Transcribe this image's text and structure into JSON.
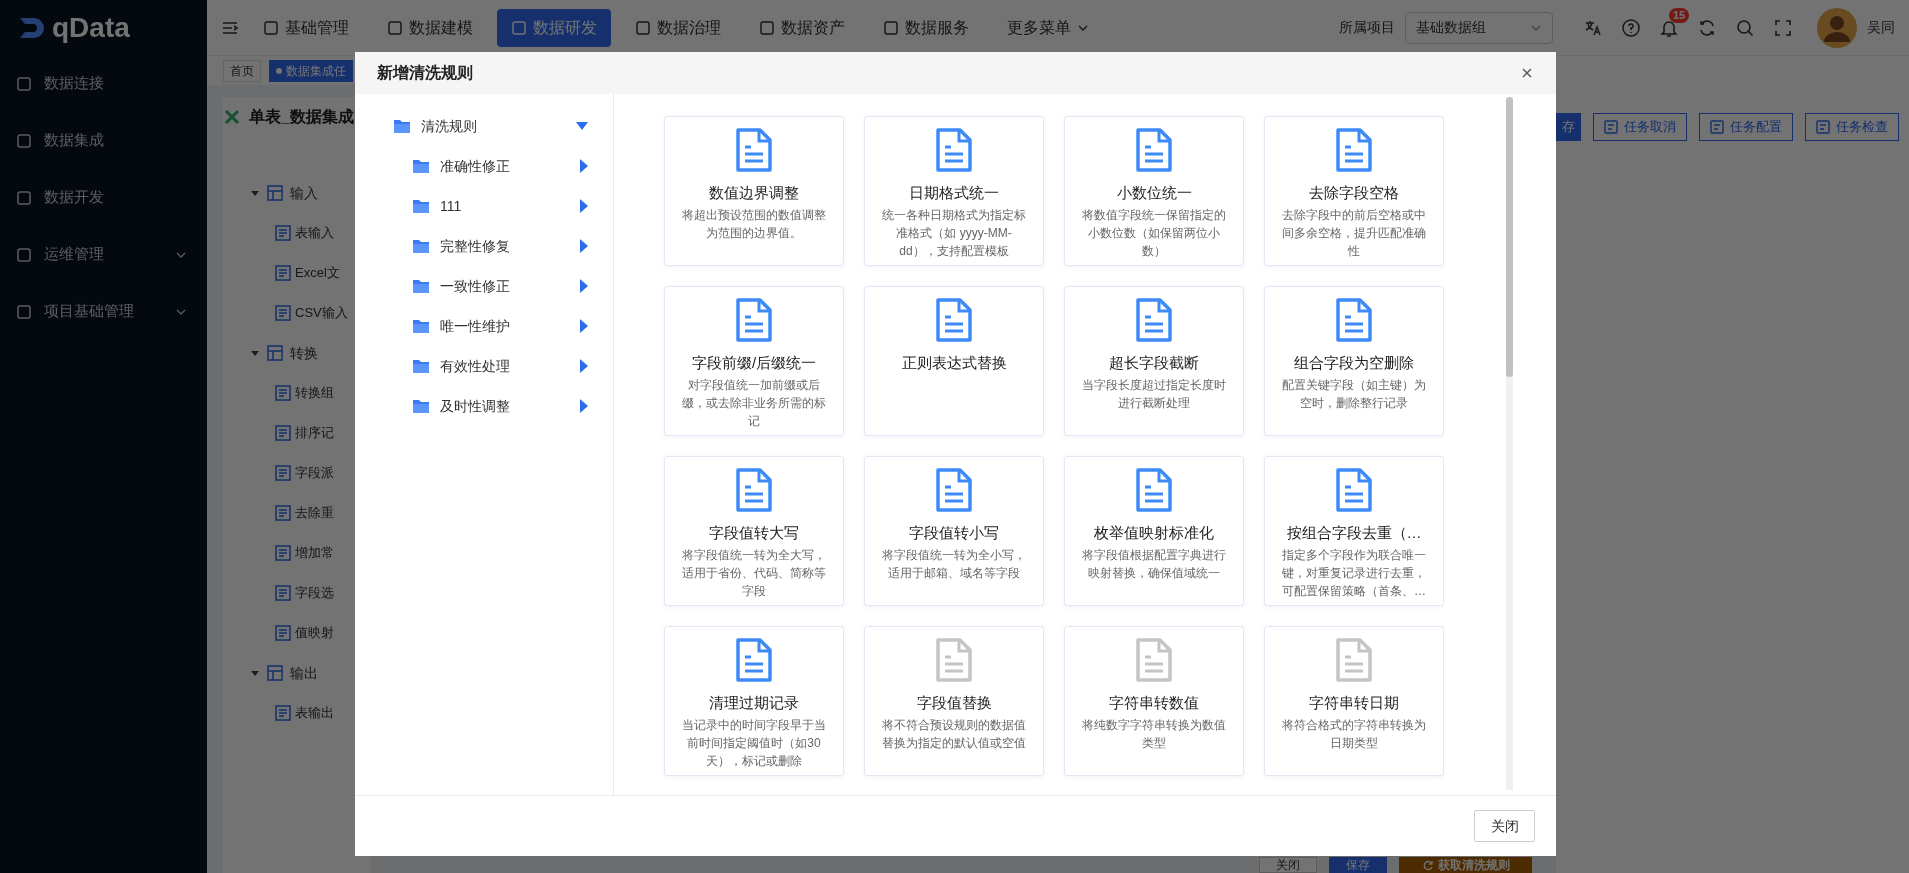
{
  "sidebar": {
    "logo": "qData",
    "items": [
      {
        "label": "数据连接",
        "kind": "link"
      },
      {
        "label": "数据集成",
        "kind": "link"
      },
      {
        "label": "数据开发",
        "kind": "link"
      },
      {
        "label": "运维管理",
        "kind": "group"
      },
      {
        "label": "项目基础管理",
        "kind": "group"
      }
    ]
  },
  "topbar": {
    "nav": [
      {
        "label": "基础管理",
        "selected": false,
        "kind": "link"
      },
      {
        "label": "数据建模",
        "selected": false,
        "kind": "link"
      },
      {
        "label": "数据研发",
        "selected": true,
        "kind": "link"
      },
      {
        "label": "数据治理",
        "selected": false,
        "kind": "link"
      },
      {
        "label": "数据资产",
        "selected": false,
        "kind": "link"
      },
      {
        "label": "数据服务",
        "selected": false,
        "kind": "link"
      },
      {
        "label": "更多菜单",
        "selected": false,
        "kind": "dropdown"
      }
    ],
    "project_label": "所属项目",
    "project_value": "基础数据组",
    "notification_count": "15",
    "user": "吴同"
  },
  "tabs": [
    {
      "label": "首页",
      "selected": false
    },
    {
      "label": "数据集成任",
      "selected": true
    }
  ],
  "task": {
    "title": "单表_数据集成",
    "toolbar": [
      {
        "label": "存",
        "kind": "primary"
      },
      {
        "label": "任务取消",
        "kind": "outline"
      },
      {
        "label": "任务配置",
        "kind": "outline"
      },
      {
        "label": "任务检查",
        "kind": "outline"
      }
    ],
    "tree": [
      {
        "label": "输入",
        "expanded": true,
        "children": [
          {
            "label": "表输入"
          },
          {
            "label": "Excel文"
          },
          {
            "label": "CSV输入"
          }
        ]
      },
      {
        "label": "转换",
        "expanded": true,
        "children": [
          {
            "label": "转换组"
          },
          {
            "label": "排序记"
          },
          {
            "label": "字段派"
          },
          {
            "label": "去除重"
          },
          {
            "label": "增加常"
          },
          {
            "label": "字段选"
          },
          {
            "label": "值映射"
          }
        ]
      },
      {
        "label": "输出",
        "expanded": true,
        "children": [
          {
            "label": "表输出"
          }
        ]
      }
    ],
    "footer_buttons": [
      {
        "label": "关闭",
        "kind": "default"
      },
      {
        "label": "保存",
        "kind": "primary"
      },
      {
        "label": "获取清洗规则",
        "kind": "warning"
      }
    ]
  },
  "dialog": {
    "title": "新增清洗规则",
    "tree": {
      "label": "清洗规则",
      "expanded": true,
      "children": [
        {
          "label": "准确性修正",
          "expanded": false
        },
        {
          "label": "111",
          "expanded": false
        },
        {
          "label": "完整性修复",
          "expanded": false
        },
        {
          "label": "一致性修正",
          "expanded": false
        },
        {
          "label": "唯一性维护",
          "expanded": false
        },
        {
          "label": "有效性处理",
          "expanded": false
        },
        {
          "label": "及时性调整",
          "expanded": false
        }
      ]
    },
    "rules": [
      {
        "title": "数值边界调整",
        "description": "将超出预设范围的数值调整为范围的边界值。",
        "disabled": false
      },
      {
        "title": "日期格式统一",
        "description": "统一各种日期格式为指定标准格式（如 yyyy-MM-dd），支持配置模板",
        "disabled": false
      },
      {
        "title": "小数位统一",
        "description": "将数值字段统一保留指定的小数位数（如保留两位小数）",
        "disabled": false
      },
      {
        "title": "去除字段空格",
        "description": "去除字段中的前后空格或中间多余空格，提升匹配准确性",
        "disabled": false
      },
      {
        "title": "字段前缀/后缀统一",
        "description": "对字段值统一加前缀或后缀，或去除非业务所需的标记",
        "disabled": false
      },
      {
        "title": "正则表达式替换",
        "disabled": false
      },
      {
        "title": "超长字段截断",
        "description": "当字段长度超过指定长度时进行截断处理",
        "disabled": false
      },
      {
        "title": "组合字段为空删除",
        "description": "配置关键字段（如主键）为空时，删除整行记录",
        "disabled": false
      },
      {
        "title": "字段值转大写",
        "description": "将字段值统一转为全大写，适用于省份、代码、简称等字段",
        "disabled": false
      },
      {
        "title": "字段值转小写",
        "description": "将字段值统一转为全小写，适用于邮箱、域名等字段",
        "disabled": false
      },
      {
        "title": "枚举值映射标准化",
        "description": "将字段值根据配置字典进行映射替换，确保值域统一",
        "disabled": false
      },
      {
        "title": "按组合字段去重（…",
        "description": "指定多个字段作为联合唯一键，对重复记录进行去重，可配置保留策略（首条、…",
        "disabled": false
      },
      {
        "title": "清理过期记录",
        "description": "当记录中的时间字段早于当前时间指定阈值时（如30天），标记或删除",
        "disabled": false
      },
      {
        "title": "字段值替换",
        "description": "将不符合预设规则的数据值替换为指定的默认值或空值",
        "disabled": true
      },
      {
        "title": "字符串转数值",
        "description": "将纯数字字符串转换为数值类型",
        "disabled": true
      },
      {
        "title": "字符串转日期",
        "description": "将符合格式的字符串转换为日期类型",
        "disabled": true
      }
    ],
    "close_button": "关闭"
  }
}
